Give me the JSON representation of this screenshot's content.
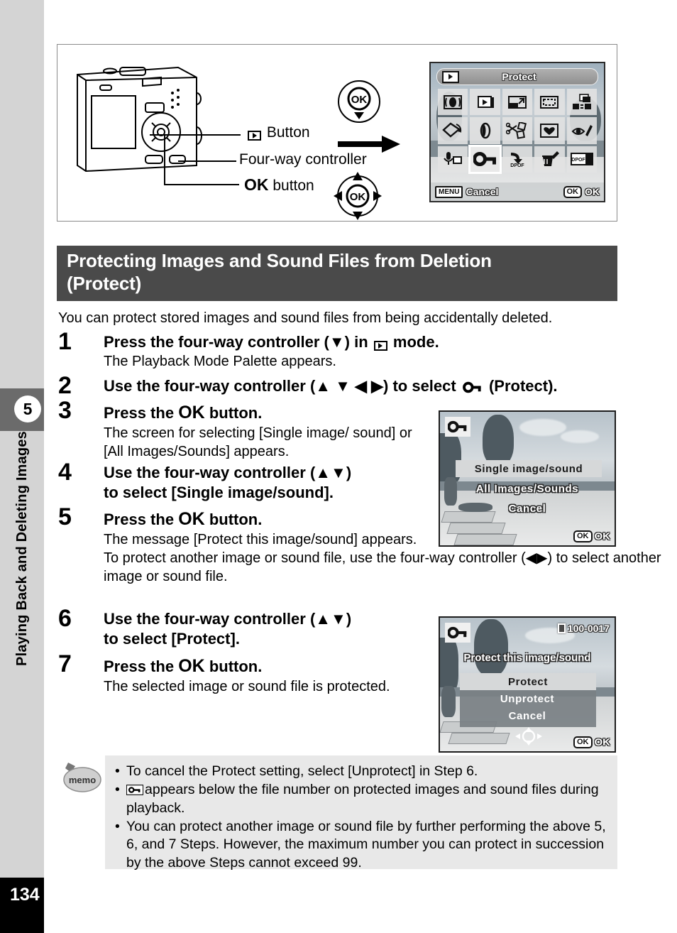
{
  "sidebar": {
    "chapter_number": "5",
    "chapter_title": "Playing Back and Deleting Images",
    "page_number": "134"
  },
  "figure": {
    "callouts": {
      "playback_button": "Button",
      "four_way_controller": "Four-way controller",
      "ok_button_prefix": "OK",
      "ok_button_suffix": "button"
    },
    "icons": {
      "playback": "playback-icon",
      "ok_down": "ok-down-arrow-icon",
      "ok_fourway": "ok-four-way-icon",
      "arrow": "right-arrow-icon"
    },
    "lcd_palette": {
      "title": "Protect",
      "title_icon": "playback-icon",
      "menu_chip": "MENU",
      "cancel_label": "Cancel",
      "ok_chip": "OK",
      "ok_label": "OK",
      "selected_index": 11,
      "items": [
        {
          "name": "slideshow-icon",
          "label": "Slideshow"
        },
        {
          "name": "playback-icon",
          "label": "Playback"
        },
        {
          "name": "resize-icon",
          "label": "Resize"
        },
        {
          "name": "crop-frame-icon",
          "label": "Cropping"
        },
        {
          "name": "image-copy-icon",
          "label": "Image/Sound Copy"
        },
        {
          "name": "rotate-icon",
          "label": "Image Rotation"
        },
        {
          "name": "digital-filter-icon",
          "label": "Digital Filter"
        },
        {
          "name": "movie-edit-icon",
          "label": "Movie Edit"
        },
        {
          "name": "frame-composite-icon",
          "label": "Frame Composite"
        },
        {
          "name": "red-eye-icon",
          "label": "Red-eye Compensation"
        },
        {
          "name": "voice-memo-icon",
          "label": "Voice Memo"
        },
        {
          "name": "protect-key-icon",
          "label": "Protect"
        },
        {
          "name": "dpof-icon",
          "label": "DPOF"
        },
        {
          "name": "delete-icon",
          "label": "Delete"
        },
        {
          "name": "start-screen-icon",
          "label": "Start-up Screen"
        }
      ]
    }
  },
  "heading": {
    "line1": "Protecting Images and Sound Files from Deletion",
    "line2": "(Protect)"
  },
  "intro": "You can protect stored images and sound files from being accidentally deleted.",
  "steps": [
    {
      "number": "1",
      "head_before": "Press the four-way controller (",
      "head_arrow": "▼",
      "head_mid": ") in",
      "head_after": "mode.",
      "sub": "The Playback Mode Palette appears."
    },
    {
      "number": "2",
      "head_before": "Use the four-way controller (",
      "head_arrows": "▲ ▼ ◀ ▶",
      "head_mid": ") to select",
      "head_after": "(Protect)."
    },
    {
      "number": "3",
      "head_before": "Press the",
      "head_ok": "OK",
      "head_after": "button.",
      "sub": "The screen for selecting [Single image/ sound] or [All Images/Sounds] appears."
    },
    {
      "number": "4",
      "head_line1": "Use the four-way controller (▲▼)",
      "head_line2": "to select [Single image/sound]."
    },
    {
      "number": "5",
      "head_before": "Press the",
      "head_ok": "OK",
      "head_after": "button.",
      "sub1": "The message [Protect this image/sound] appears.",
      "sub2": "To protect another image or sound file, use the four-way controller (◀▶) to select another image or sound file."
    },
    {
      "number": "6",
      "head_line1": "Use the four-way controller (▲▼)",
      "head_line2": "to select [Protect]."
    },
    {
      "number": "7",
      "head_before": "Press the",
      "head_ok": "OK",
      "head_after": "button.",
      "sub": "The selected image or sound file is protected."
    }
  ],
  "lcd_single": {
    "badge_icon": "protect-key-icon",
    "option_selected": "Single image/sound",
    "option_2": "All Images/Sounds",
    "option_3": "Cancel",
    "ok_chip": "OK",
    "ok_label": "OK"
  },
  "lcd_protect": {
    "badge_icon": "protect-key-icon",
    "file_number": "100-0017",
    "card_icon": "memory-card-icon",
    "message": "Protect this image/sound",
    "option_selected": "Protect",
    "option_2": "Unprotect",
    "option_3": "Cancel",
    "fourway_icon": "four-way-updown-icon",
    "ok_chip": "OK",
    "ok_label": "OK"
  },
  "memo": {
    "icon_label": "memo",
    "items": [
      "To cancel the Protect setting, select [Unprotect] in Step 6.",
      "appears below the file number on protected images and sound files during playback.",
      "You can protect another image or sound file by further performing the above 5, 6, and 7 Steps. However, the maximum number you can protect in succession by the above Steps cannot exceed 99."
    ]
  },
  "colors": {
    "sidebar": "#d4d4d4",
    "chapter_tab": "#6b6b6b",
    "heading_bg": "#4a4a4a",
    "memo_bg": "#e8e8e8",
    "page_block": "#000000"
  }
}
